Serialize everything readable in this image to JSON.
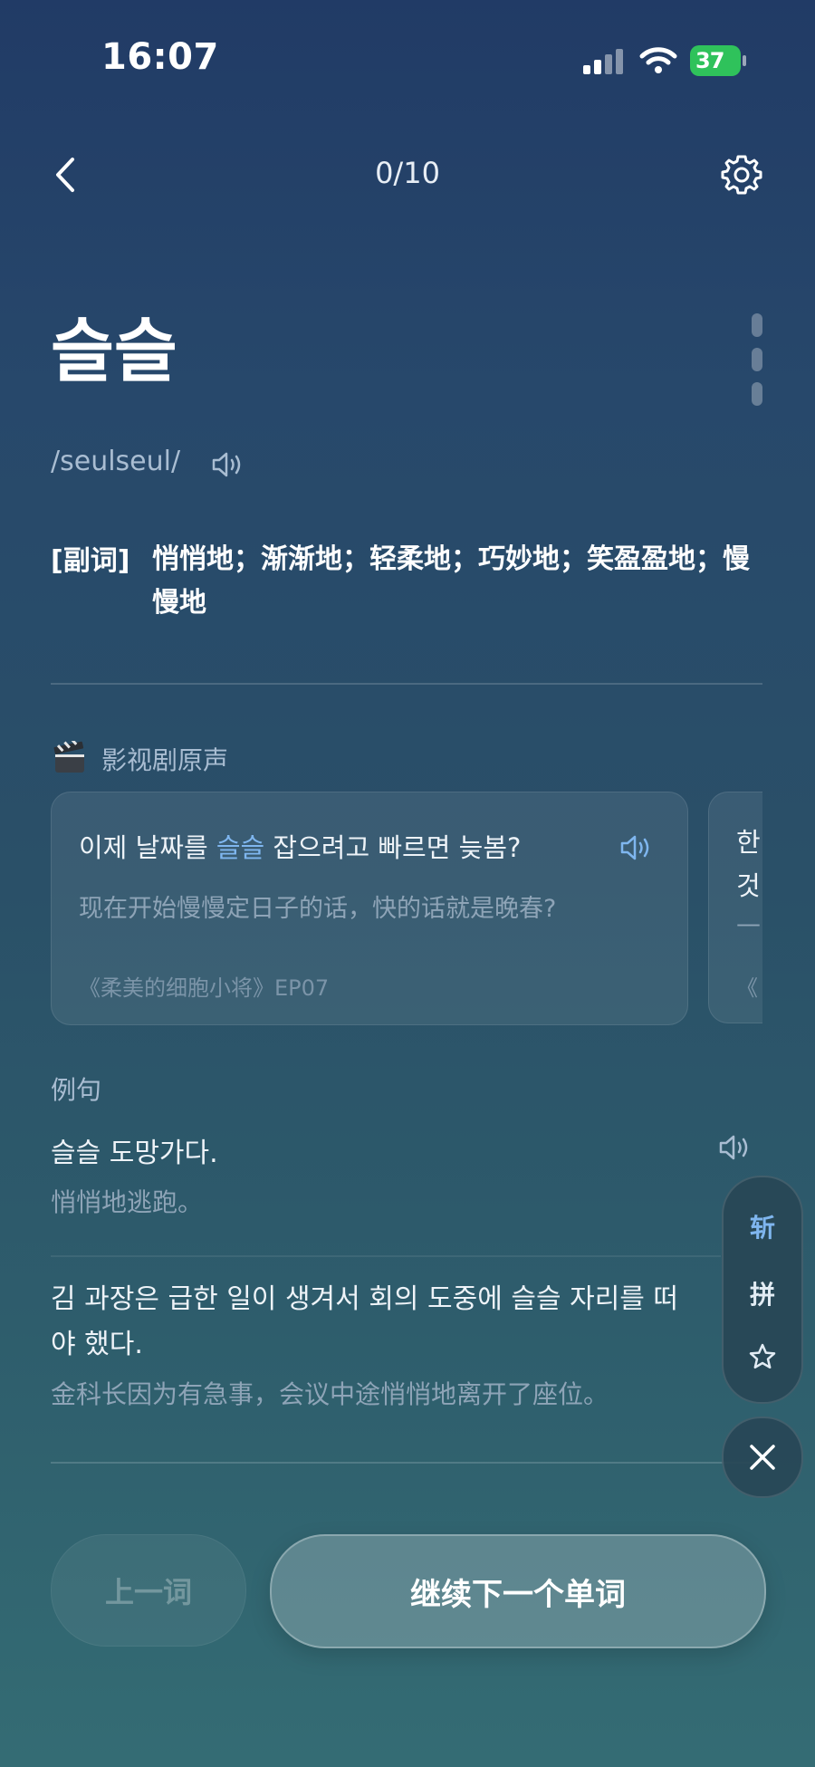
{
  "status_bar": {
    "time": "16:07",
    "battery": "37"
  },
  "header": {
    "progress": "0/10"
  },
  "word": {
    "headword": "슬슬",
    "phonetic": "/seulseul/",
    "part_of_speech": "[副词]",
    "definition": "悄悄地；渐渐地；轻柔地；巧妙地；笑盈盈地；慢慢地"
  },
  "film": {
    "section_title": "影视剧原声",
    "clips": [
      {
        "ko_before": "이제 날짜를 ",
        "ko_highlight": "슬슬",
        "ko_after": " 잡으려고 빠르면 늦봄?",
        "zh": "现在开始慢慢定日子的话，快的话就是晚春?",
        "source": "《柔美的细胞小将》EP07"
      },
      {
        "line1": "한",
        "line2": "것",
        "zh": "—",
        "source": "《"
      }
    ]
  },
  "examples": {
    "section_title": "例句",
    "items": [
      {
        "ko": "슬슬 도망가다.",
        "zh": "悄悄地逃跑。"
      },
      {
        "ko": "김 과장은 급한 일이 생겨서 회의 도중에 슬슬 자리를 떠야 했다.",
        "zh": "金科长因为有急事，会议中途悄悄地离开了座位。"
      }
    ]
  },
  "toolbar": {
    "zhan_label": "斩",
    "pin_label": "拼"
  },
  "buttons": {
    "prev": "上一词",
    "next": "继续下一个单词"
  },
  "colors": {
    "accent": "#7fb6ef",
    "battery": "#2fc25b"
  }
}
